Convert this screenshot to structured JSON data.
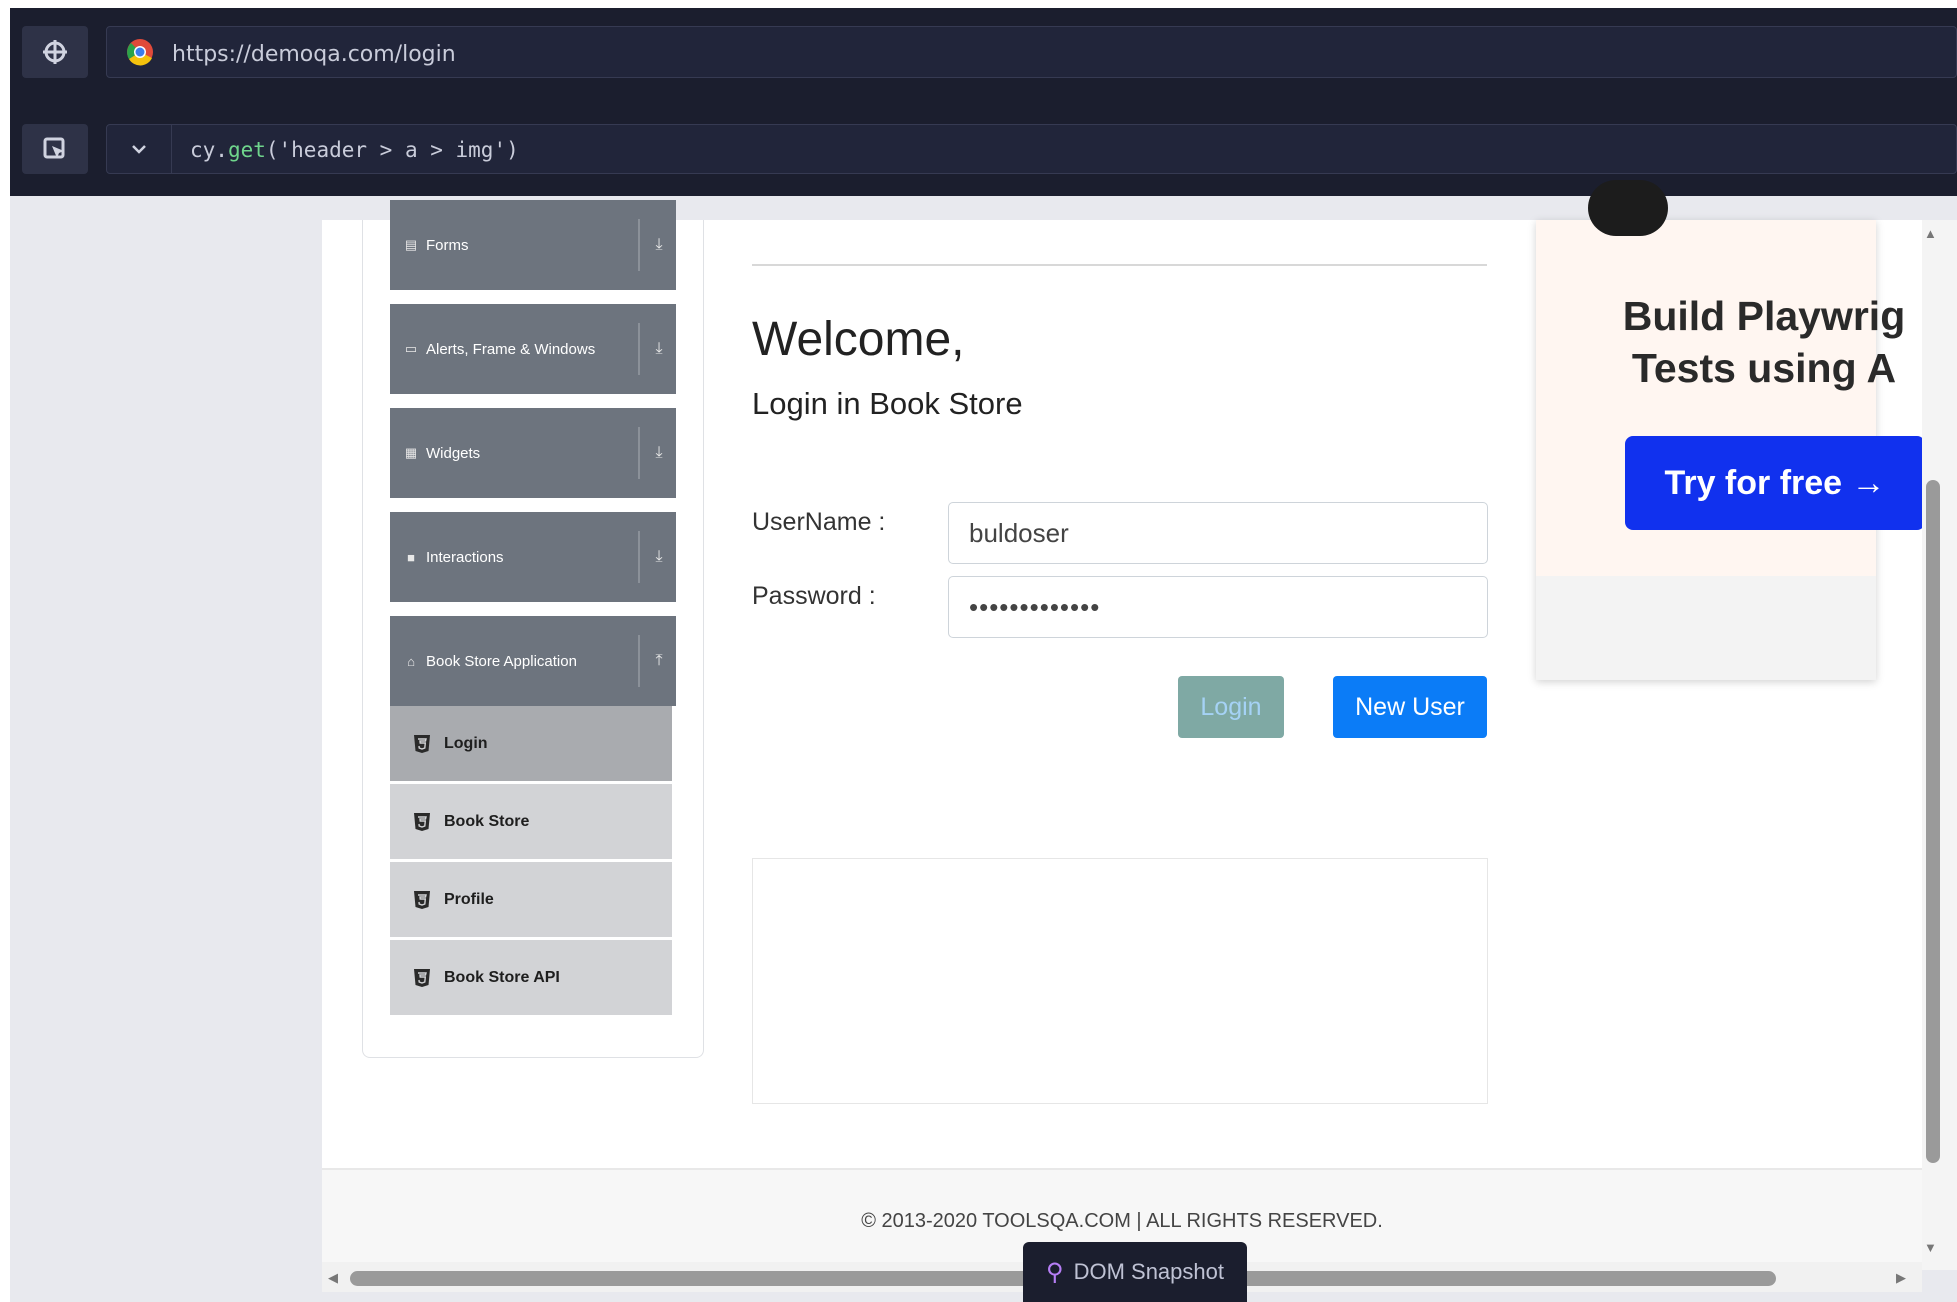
{
  "runner": {
    "url": "https://demoqa.com/login",
    "selector_prefix": "cy.",
    "selector_fn": "get",
    "selector_args": "('header > a > img')",
    "dom_snapshot_label": "DOM Snapshot",
    "icons": [
      "crosshair-icon",
      "chrome-icon",
      "selector-playground-icon",
      "chevron-down-icon",
      "map-pin-icon"
    ]
  },
  "sidebar": {
    "groups": [
      {
        "label": "Forms",
        "icon": "file-icon",
        "arrow": "download-icon"
      },
      {
        "label": "Alerts, Frame & Windows",
        "icon": "window-icon",
        "arrow": "download-icon"
      },
      {
        "label": "Widgets",
        "icon": "grid-icon",
        "arrow": "download-icon"
      },
      {
        "label": "Interactions",
        "icon": "cube-icon",
        "arrow": "download-icon"
      },
      {
        "label": "Book Store Application",
        "icon": "book-icon",
        "arrow": "upload-icon"
      }
    ],
    "items": [
      {
        "label": "Login",
        "active": true
      },
      {
        "label": "Book Store",
        "active": false
      },
      {
        "label": "Profile",
        "active": false
      },
      {
        "label": "Book Store API",
        "active": false
      }
    ]
  },
  "main": {
    "welcome": "Welcome,",
    "subtitle": "Login in Book Store",
    "username_label": "UserName :",
    "username_value": "buldoser",
    "password_label": "Password :",
    "password_value": "•••••••••••••",
    "login_button": "Login",
    "new_user_button": "New User"
  },
  "ad": {
    "heading_line1": "Build Playwrig",
    "heading_line2": "Tests using A",
    "cta": "Try for free →"
  },
  "footer": {
    "text": "© 2013-2020 TOOLSQA.COM | ALL RIGHTS RESERVED."
  },
  "colors": {
    "runner_bg": "#1b1e2e",
    "sidebar_header": "#6d747e",
    "menu_active": "#a9abaf",
    "primary_button": "#0b7cf7",
    "ad_cta": "#1131ee"
  }
}
